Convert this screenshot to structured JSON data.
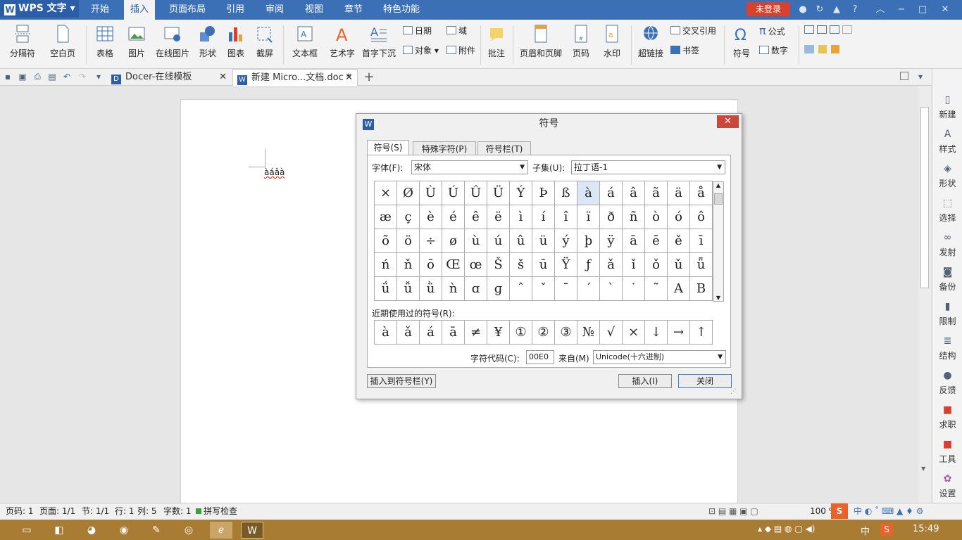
{
  "app": {
    "name": "WPS 文字",
    "logo": "W"
  },
  "menu_tabs": [
    "开始",
    "插入",
    "页面布局",
    "引用",
    "审阅",
    "视图",
    "章节",
    "特色功能"
  ],
  "active_menu_tab": "插入",
  "login": "未登录",
  "window_controls": [
    "?",
    "−",
    "□",
    "✕"
  ],
  "ribbon": {
    "buttons": [
      "分隔符",
      "空白页",
      "表格",
      "图片",
      "在线图片",
      "形状",
      "图表",
      "截屏",
      "文本框",
      "艺术字",
      "首字下沉",
      "批注",
      "页眉和页脚",
      "页码",
      "水印",
      "超链接",
      "符号"
    ],
    "small": [
      "日期",
      "域",
      "对象",
      "附件",
      "交叉引用",
      "书签",
      "公式",
      "数字"
    ]
  },
  "doc_tabs": [
    {
      "label": "Docer-在线模板"
    },
    {
      "label": "新建 Micro...文档.doc *"
    }
  ],
  "document": {
    "text": "àáǎà"
  },
  "right_panel": [
    "新建",
    "样式",
    "形状",
    "选择",
    "发射",
    "备份",
    "限制",
    "结构",
    "反馈",
    "求职",
    "工具",
    "设置"
  ],
  "status": {
    "page": "页码: 1",
    "pages": "页面: 1/1",
    "section": "节: 1/1",
    "row": "行: 1",
    "col": "列: 5",
    "words": "字数: 1",
    "spell": "拼写检查",
    "zoom": "100 %"
  },
  "taskbar": {
    "time": "15:49",
    "ime": "中"
  },
  "dialog": {
    "title": "符号",
    "tabs": [
      "符号(S)",
      "特殊字符(P)",
      "符号栏(T)"
    ],
    "font_label": "字体(F):",
    "font_value": "宋体",
    "subset_label": "子集(U):",
    "subset_value": "拉丁语-1",
    "symbols": [
      [
        "×",
        "Ø",
        "Ù",
        "Ú",
        "Û",
        "Ü",
        "Ý",
        "Þ",
        "ß",
        "à",
        "á",
        "â",
        "ã",
        "ä",
        "å"
      ],
      [
        "æ",
        "ç",
        "è",
        "é",
        "ê",
        "ë",
        "ì",
        "í",
        "î",
        "ï",
        "ð",
        "ñ",
        "ò",
        "ó",
        "ô"
      ],
      [
        "õ",
        "ö",
        "÷",
        "ø",
        "ù",
        "ú",
        "û",
        "ü",
        "ý",
        "þ",
        "ÿ",
        "ā",
        "ē",
        "ě",
        "ī"
      ],
      [
        "ń",
        "ň",
        "ō",
        "Œ",
        "œ",
        "Š",
        "š",
        "ū",
        "Ÿ",
        "ƒ",
        "ǎ",
        "ǐ",
        "ǒ",
        "ǔ",
        "ǖ"
      ],
      [
        "ǘ",
        "ǚ",
        "ǜ",
        "ǹ",
        "ɑ",
        "ɡ",
        "ˆ",
        "ˇ",
        "ˉ",
        "ˊ",
        "ˋ",
        "˙",
        "˜",
        "A",
        "B"
      ]
    ],
    "selected_symbol": "à",
    "recent_label": "近期使用过的符号(R):",
    "recent": [
      "à",
      "ǎ",
      "á",
      "ā",
      "≠",
      "¥",
      "①",
      "②",
      "③",
      "№",
      "√",
      "×",
      "↓",
      "→",
      "↑"
    ],
    "code_label": "字符代码(C):",
    "code_value": "00E0",
    "from_label": "来自(M)",
    "from_value": "Unicode(十六进制)",
    "insert_bar_btn": "插入到符号栏(Y)",
    "insert_btn": "插入(I)",
    "close_btn": "关闭"
  }
}
